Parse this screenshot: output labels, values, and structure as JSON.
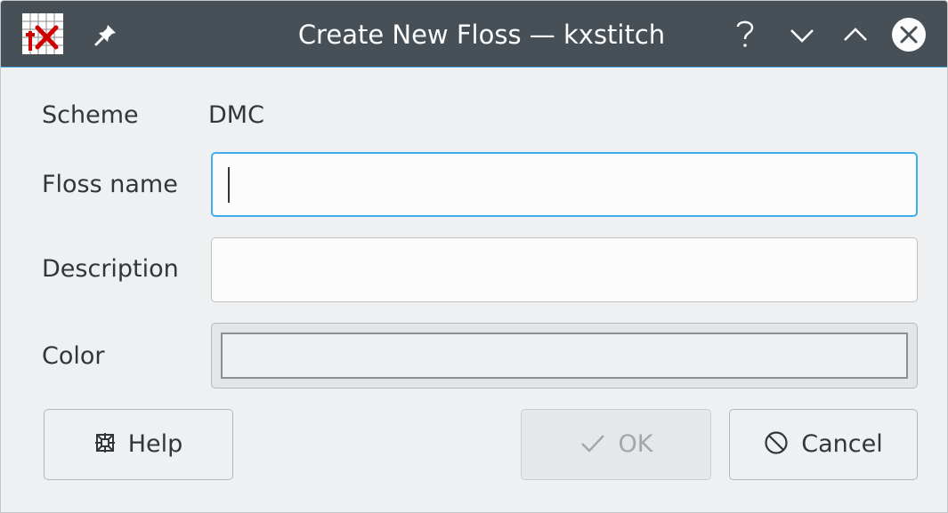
{
  "window": {
    "title": "Create New Floss — kxstitch",
    "icons": {
      "app": "kxstitch-app-icon",
      "pin": "pin-icon",
      "help": "help-icon",
      "minimize": "minimize-icon",
      "maximize": "maximize-icon",
      "close": "close-icon"
    },
    "colors": {
      "titlebar": "#475057",
      "background": "#eff0f1",
      "focus": "#3daee9"
    }
  },
  "form": {
    "scheme_label": "Scheme",
    "scheme_value": "DMC",
    "floss_name_label": "Floss name",
    "floss_name_value": "",
    "description_label": "Description",
    "description_value": "",
    "color_label": "Color"
  },
  "buttons": {
    "help": {
      "label": "Help",
      "icon": "lifebuoy-icon"
    },
    "ok": {
      "label": "OK",
      "icon": "checkmark-icon",
      "enabled": false
    },
    "cancel": {
      "label": "Cancel",
      "icon": "cancel-circle-icon"
    }
  }
}
